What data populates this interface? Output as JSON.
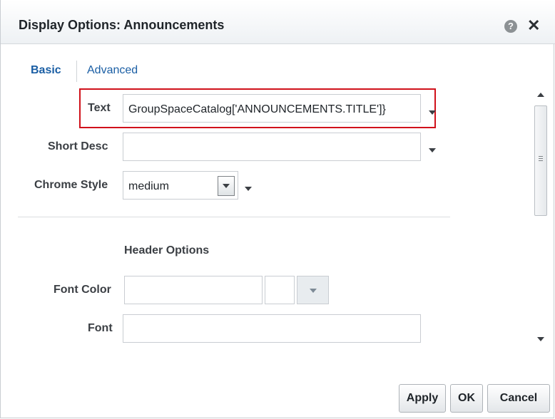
{
  "dialog": {
    "title": "Display Options: Announcements",
    "help_glyph": "?",
    "close_glyph": "✕"
  },
  "tabs": [
    {
      "label": "Basic",
      "selected": true
    },
    {
      "label": "Advanced",
      "selected": false
    }
  ],
  "fields": {
    "text": {
      "label": "Text",
      "value": "GroupSpaceCatalog['ANNOUNCEMENTS.TITLE']}"
    },
    "short_desc": {
      "label": "Short Desc",
      "value": ""
    },
    "chrome_style": {
      "label": "Chrome Style",
      "value": "medium"
    },
    "header_options": {
      "label": "Header Options"
    },
    "font_color": {
      "label": "Font Color",
      "value": ""
    },
    "font": {
      "label": "Font",
      "value": ""
    }
  },
  "buttons": {
    "apply": "Apply",
    "ok": "OK",
    "cancel": "Cancel"
  },
  "colors": {
    "highlight_border": "#d0111b",
    "tab_link": "#1a5ea4"
  },
  "icons": [
    "help-icon",
    "close-icon",
    "expression-menu-icon",
    "dropdown-arrow-icon",
    "scroll-up-icon",
    "scroll-down-icon"
  ]
}
